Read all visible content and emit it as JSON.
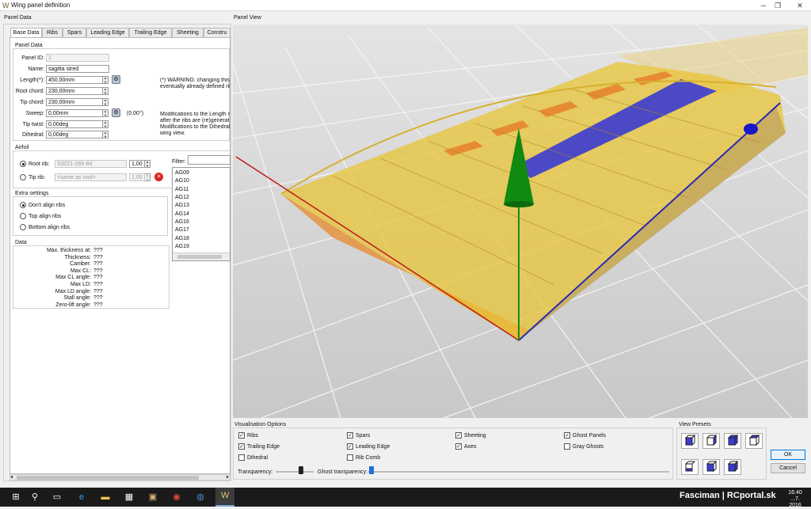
{
  "window": {
    "title": "Wing panel definition"
  },
  "left_panel": {
    "title": "Panel Data",
    "tabs": [
      "Base Data",
      "Ribs",
      "Spars",
      "Leading Edge",
      "Trailing Edge",
      "Sheeting",
      "Constru"
    ],
    "panel_data": {
      "group_title": "Panel Data",
      "panel_id_label": "Panel ID:",
      "panel_id": "1",
      "name_label": "Name:",
      "name": "sagitta stred",
      "length_label": "Length(*):",
      "length": "450,00mm",
      "root_chord_label": "Root chord:",
      "root_chord": "230,00mm",
      "tip_chord_label": "Tip chord:",
      "tip_chord": "230,00mm",
      "sweep_label": "Sweep:",
      "sweep": "0,00mm",
      "sweep_deg": "(0.00°)",
      "tip_twist_label": "Tip twist:",
      "tip_twist": "0,00deg",
      "dihedral_label": "Dihedral:",
      "dihedral": "0,00deg",
      "warning_line1": "(*) WARNING: changing this v",
      "warning_line2": "eventually already defined ribs",
      "note_line1": "Modifications to the Length se",
      "note_line2": "after the ribs are (re)generat",
      "note_line3": "Modifications to the Dihedral's",
      "note_line4": "wing view."
    },
    "airfoil": {
      "group_title": "Airfoil",
      "root_rib_label": "Root rib:",
      "root_rib": "S3021-095-84",
      "root_rib_scale": "1,00",
      "tip_rib_label": "Tip rib:",
      "tip_rib": "<same as root>",
      "tip_rib_scale": "1,00",
      "filter_label": "Filter:",
      "airfoil_list": [
        "AG09",
        "AG10",
        "AG11",
        "AG12",
        "AG13",
        "AG14",
        "AG16",
        "AG17",
        "AG18",
        "AG19"
      ]
    },
    "extra_settings": {
      "group_title": "Extra settings",
      "options": [
        "Don't align ribs",
        "Top align ribs",
        "Bottom align ribs"
      ]
    },
    "data": {
      "group_title": "Data",
      "rows": [
        {
          "label": "Max. thickness at:",
          "value": "???"
        },
        {
          "label": "Thickness:",
          "value": "???"
        },
        {
          "label": "Camber:",
          "value": "???"
        },
        {
          "label": "Max CL:",
          "value": "???"
        },
        {
          "label": "Max CL angle:",
          "value": "???"
        },
        {
          "label": "Max LD:",
          "value": "???"
        },
        {
          "label": "Max LD angle:",
          "value": "???"
        },
        {
          "label": "Stall angle:",
          "value": "???"
        },
        {
          "label": "Zero-lift angle:",
          "value": "???"
        }
      ]
    }
  },
  "panel_view": {
    "title": "Panel View"
  },
  "visualisation": {
    "title": "Visualisation Options",
    "options": [
      {
        "label": "Ribs",
        "checked": true
      },
      {
        "label": "Spars",
        "checked": true
      },
      {
        "label": "Sheeting",
        "checked": true
      },
      {
        "label": "Ghost Panels",
        "checked": true
      },
      {
        "label": "Trailing Edge",
        "checked": true
      },
      {
        "label": "Leading Edge",
        "checked": true
      },
      {
        "label": "Axes",
        "checked": true
      },
      {
        "label": "Gray Ghosts",
        "checked": false
      },
      {
        "label": "Dihedral",
        "checked": false
      },
      {
        "label": "Rib Comb",
        "checked": false
      }
    ],
    "transparency_label": "Transparency:",
    "ghost_transparency_label": "Ghost transparency:"
  },
  "view_presets": {
    "title": "View Presets"
  },
  "buttons": {
    "ok": "OK",
    "cancel": "Cancel"
  },
  "taskbar": {
    "time": "16:40",
    "date": "...7. 2016",
    "watermark": "Fasciman | RCportal.sk"
  },
  "colors": {
    "wing_yellow": "#e8c436",
    "spar_blue": "#3b3bd0",
    "axis_green": "#1a8a1a",
    "axis_red": "#c01818"
  }
}
